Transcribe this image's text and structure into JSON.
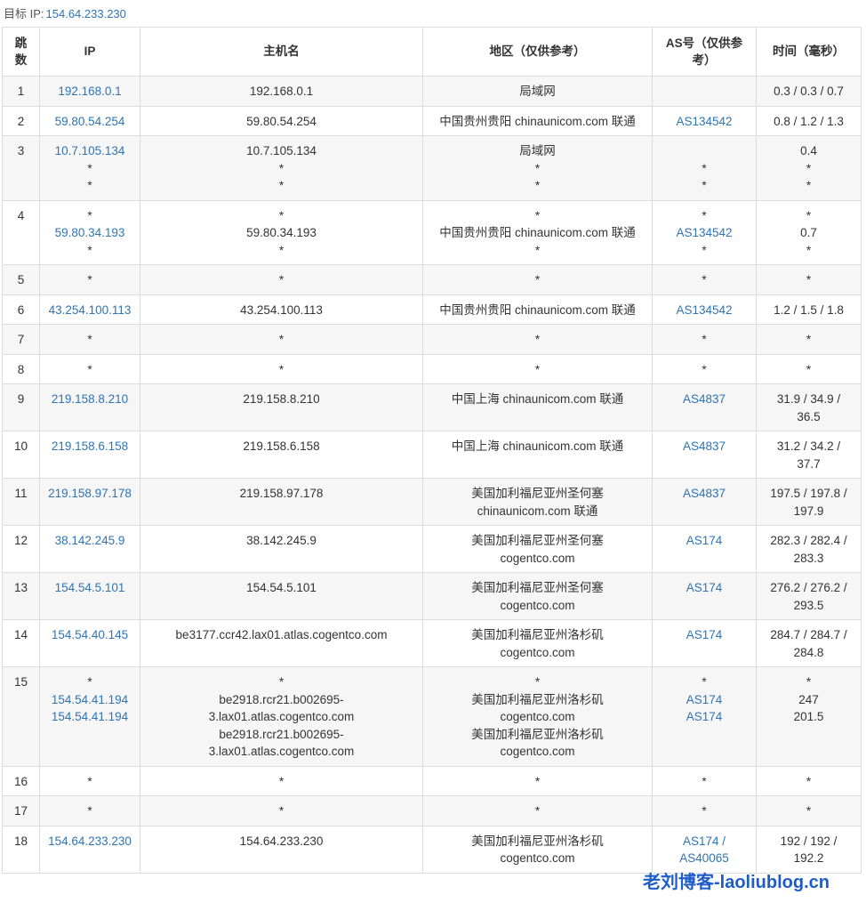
{
  "target": {
    "label": "目标 IP:",
    "ip": "154.64.233.230"
  },
  "headers": {
    "hop": "跳数",
    "ip": "IP",
    "host": "主机名",
    "region": "地区（仅供参考）",
    "asn": "AS号（仅供参考）",
    "time": "时间（毫秒）"
  },
  "rows": [
    {
      "hop": "1",
      "ip": [
        "192.168.0.1"
      ],
      "host": [
        "192.168.0.1"
      ],
      "region": [
        "局域网"
      ],
      "asn": [
        ""
      ],
      "time": [
        "0.3 / 0.3 / 0.7"
      ]
    },
    {
      "hop": "2",
      "ip": [
        "59.80.54.254"
      ],
      "host": [
        "59.80.54.254"
      ],
      "region": [
        "中国贵州贵阳 chinaunicom.com 联通"
      ],
      "asn": [
        "AS134542"
      ],
      "time": [
        "0.8 / 1.2 / 1.3"
      ]
    },
    {
      "hop": "3",
      "ip": [
        "10.7.105.134",
        "*",
        "*"
      ],
      "host": [
        "10.7.105.134",
        "*",
        "*"
      ],
      "region": [
        "局域网",
        "*",
        "*"
      ],
      "asn": [
        "",
        "*",
        "*"
      ],
      "time": [
        "0.4",
        "*",
        "*"
      ]
    },
    {
      "hop": "4",
      "ip": [
        "*",
        "59.80.34.193",
        "*"
      ],
      "host": [
        "*",
        "59.80.34.193",
        "*"
      ],
      "region": [
        "*",
        "中国贵州贵阳 chinaunicom.com 联通",
        "*"
      ],
      "asn": [
        "*",
        "AS134542",
        "*"
      ],
      "time": [
        "*",
        "0.7",
        "*"
      ]
    },
    {
      "hop": "5",
      "ip": [
        "*"
      ],
      "host": [
        "*"
      ],
      "region": [
        "*"
      ],
      "asn": [
        "*"
      ],
      "time": [
        "*"
      ]
    },
    {
      "hop": "6",
      "ip": [
        "43.254.100.113"
      ],
      "host": [
        "43.254.100.113"
      ],
      "region": [
        "中国贵州贵阳 chinaunicom.com 联通"
      ],
      "asn": [
        "AS134542"
      ],
      "time": [
        "1.2 / 1.5 / 1.8"
      ]
    },
    {
      "hop": "7",
      "ip": [
        "*"
      ],
      "host": [
        "*"
      ],
      "region": [
        "*"
      ],
      "asn": [
        "*"
      ],
      "time": [
        "*"
      ]
    },
    {
      "hop": "8",
      "ip": [
        "*"
      ],
      "host": [
        "*"
      ],
      "region": [
        "*"
      ],
      "asn": [
        "*"
      ],
      "time": [
        "*"
      ]
    },
    {
      "hop": "9",
      "ip": [
        "219.158.8.210"
      ],
      "host": [
        "219.158.8.210"
      ],
      "region": [
        "中国上海 chinaunicom.com 联通"
      ],
      "asn": [
        "AS4837"
      ],
      "time": [
        "31.9 / 34.9 /",
        "36.5"
      ]
    },
    {
      "hop": "10",
      "ip": [
        "219.158.6.158"
      ],
      "host": [
        "219.158.6.158"
      ],
      "region": [
        "中国上海 chinaunicom.com 联通"
      ],
      "asn": [
        "AS4837"
      ],
      "time": [
        "31.2 / 34.2 /",
        "37.7"
      ]
    },
    {
      "hop": "11",
      "ip": [
        "219.158.97.178"
      ],
      "host": [
        "219.158.97.178"
      ],
      "region": [
        "美国加利福尼亚州圣何塞",
        "chinaunicom.com 联通"
      ],
      "asn": [
        "AS4837"
      ],
      "time": [
        "197.5 / 197.8 /",
        "197.9"
      ]
    },
    {
      "hop": "12",
      "ip": [
        "38.142.245.9"
      ],
      "host": [
        "38.142.245.9"
      ],
      "region": [
        "美国加利福尼亚州圣何塞",
        "cogentco.com"
      ],
      "asn": [
        "AS174"
      ],
      "time": [
        "282.3 / 282.4 /",
        "283.3"
      ]
    },
    {
      "hop": "13",
      "ip": [
        "154.54.5.101"
      ],
      "host": [
        "154.54.5.101"
      ],
      "region": [
        "美国加利福尼亚州圣何塞",
        "cogentco.com"
      ],
      "asn": [
        "AS174"
      ],
      "time": [
        "276.2 / 276.2 /",
        "293.5"
      ]
    },
    {
      "hop": "14",
      "ip": [
        "154.54.40.145"
      ],
      "host": [
        "be3177.ccr42.lax01.atlas.cogentco.com"
      ],
      "region": [
        "美国加利福尼亚州洛杉矶",
        "cogentco.com"
      ],
      "asn": [
        "AS174"
      ],
      "time": [
        "284.7 / 284.7 /",
        "284.8"
      ]
    },
    {
      "hop": "15",
      "ip": [
        "*",
        "154.54.41.194",
        "154.54.41.194"
      ],
      "host": [
        "*",
        "be2918.rcr21.b002695-",
        "3.lax01.atlas.cogentco.com",
        "be2918.rcr21.b002695-",
        "3.lax01.atlas.cogentco.com"
      ],
      "region": [
        "*",
        "美国加利福尼亚州洛杉矶",
        "cogentco.com",
        "美国加利福尼亚州洛杉矶",
        "cogentco.com"
      ],
      "asn": [
        "*",
        "AS174",
        "AS174"
      ],
      "time": [
        "*",
        "247",
        "201.5"
      ]
    },
    {
      "hop": "16",
      "ip": [
        "*"
      ],
      "host": [
        "*"
      ],
      "region": [
        "*"
      ],
      "asn": [
        "*"
      ],
      "time": [
        "*"
      ]
    },
    {
      "hop": "17",
      "ip": [
        "*"
      ],
      "host": [
        "*"
      ],
      "region": [
        "*"
      ],
      "asn": [
        "*"
      ],
      "time": [
        "*"
      ]
    },
    {
      "hop": "18",
      "ip": [
        "154.64.233.230"
      ],
      "host": [
        "154.64.233.230"
      ],
      "region": [
        "美国加利福尼亚州洛杉矶",
        "cogentco.com"
      ],
      "asn": [
        "AS174 /",
        "AS40065"
      ],
      "time": [
        "192 / 192 /",
        "192.2"
      ]
    }
  ],
  "watermark": "老刘博客-laoliublog.cn"
}
